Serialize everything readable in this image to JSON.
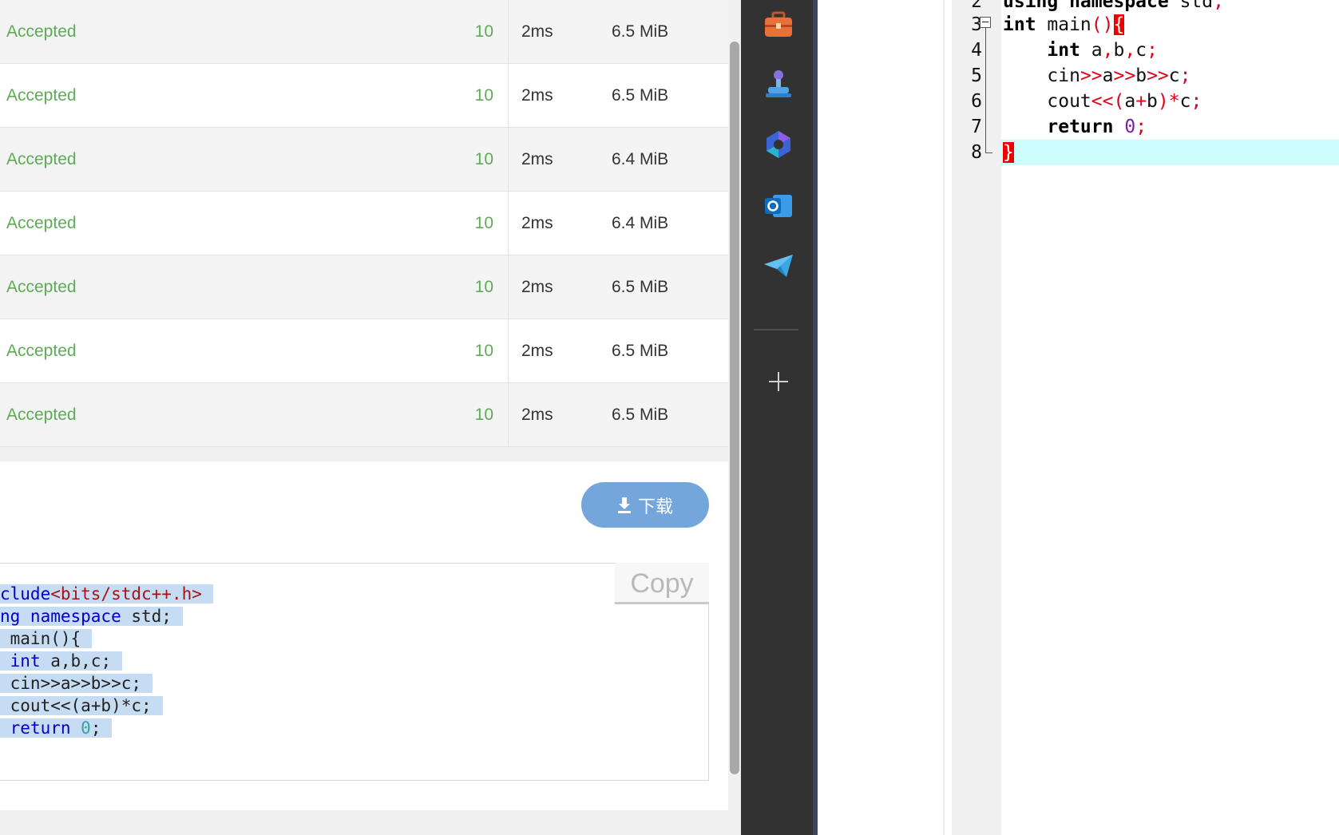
{
  "results": {
    "rows": [
      {
        "status": "Accepted",
        "score": "10",
        "time": "2ms",
        "memory": "6.5 MiB"
      },
      {
        "status": "Accepted",
        "score": "10",
        "time": "2ms",
        "memory": "6.5 MiB"
      },
      {
        "status": "Accepted",
        "score": "10",
        "time": "2ms",
        "memory": "6.4 MiB"
      },
      {
        "status": "Accepted",
        "score": "10",
        "time": "2ms",
        "memory": "6.4 MiB"
      },
      {
        "status": "Accepted",
        "score": "10",
        "time": "2ms",
        "memory": "6.5 MiB"
      },
      {
        "status": "Accepted",
        "score": "10",
        "time": "2ms",
        "memory": "6.5 MiB"
      },
      {
        "status": "Accepted",
        "score": "10",
        "time": "2ms",
        "memory": "6.5 MiB"
      }
    ]
  },
  "download": {
    "label": "下载",
    "icon": "download-icon"
  },
  "code_viewer": {
    "copy_label": "Copy",
    "lines": [
      "clude<bits/stdc++.h>",
      "ng namespace std;",
      " main(){",
      " int a,b,c;",
      " cin>>a>>b>>c;",
      " cout<<(a+b)*c;",
      " return 0;"
    ]
  },
  "dock": {
    "items": [
      {
        "name": "toolbox-icon"
      },
      {
        "name": "joystick-icon"
      },
      {
        "name": "copilot-icon"
      },
      {
        "name": "outlook-icon"
      },
      {
        "name": "telegram-icon"
      }
    ],
    "add_icon": "plus-icon"
  },
  "editor": {
    "line_numbers": [
      "2",
      "3",
      "4",
      "5",
      "6",
      "7",
      "8"
    ],
    "lines": [
      "using namespace std;",
      "int main(){",
      "    int a,b,c;",
      "    cin>>a>>b>>c;",
      "    cout<<(a+b)*c;",
      "    return 0;",
      "}"
    ],
    "current_line": "8"
  },
  "colors": {
    "accepted": "#5cac55",
    "download_button": "#74a6dc",
    "dock_bg": "#323232",
    "current_line_highlight": "#cdfdfd",
    "brace_match": "#ee0000"
  }
}
